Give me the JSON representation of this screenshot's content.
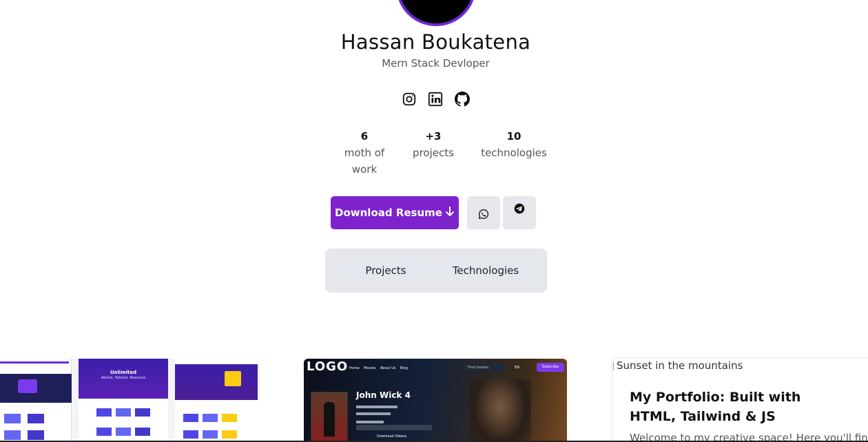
{
  "profile": {
    "name": "Hassan Boukatena",
    "role": "Mern Stack Devloper"
  },
  "socials": [
    {
      "icon": "instagram-icon"
    },
    {
      "icon": "linkedin-icon"
    },
    {
      "icon": "github-icon"
    }
  ],
  "stats": [
    {
      "value": "6",
      "label_line1": "moth of",
      "label_line2": "work"
    },
    {
      "value": "+3",
      "label_line1": "projects"
    },
    {
      "value": "10",
      "label_line1": "technologies"
    }
  ],
  "actions": {
    "resume_label": "Download Resume",
    "resume_icon": "arrow-down-icon",
    "whatsapp_icon": "whatsapp-icon",
    "telegram_icon": "telegram-icon"
  },
  "tabs": [
    "Projects",
    "Technologies"
  ],
  "cards": {
    "card2": {
      "logo": "LOGO",
      "nav": [
        "Home",
        "Movies",
        "About Us",
        "Blog"
      ],
      "search_placeholder": "Find movies..",
      "lang": "EN",
      "subscribe": "Subscribe",
      "movie_title": "John Wick 4",
      "download": "Download Videos"
    },
    "card1": {
      "hero_title": "Unlimited",
      "hero_sub": "Advice, Tutorial, Resource"
    },
    "card3": {
      "image_alt": "Sunset in the mountains",
      "title": "My Portfolio: Built with HTML, Tailwind & JS",
      "description": "Welcome to my creative space! Here you'll find a"
    }
  },
  "colors": {
    "accent": "#7e22ce",
    "avatar_ring": "#6d28d9",
    "button_gray": "#e5e7eb"
  }
}
